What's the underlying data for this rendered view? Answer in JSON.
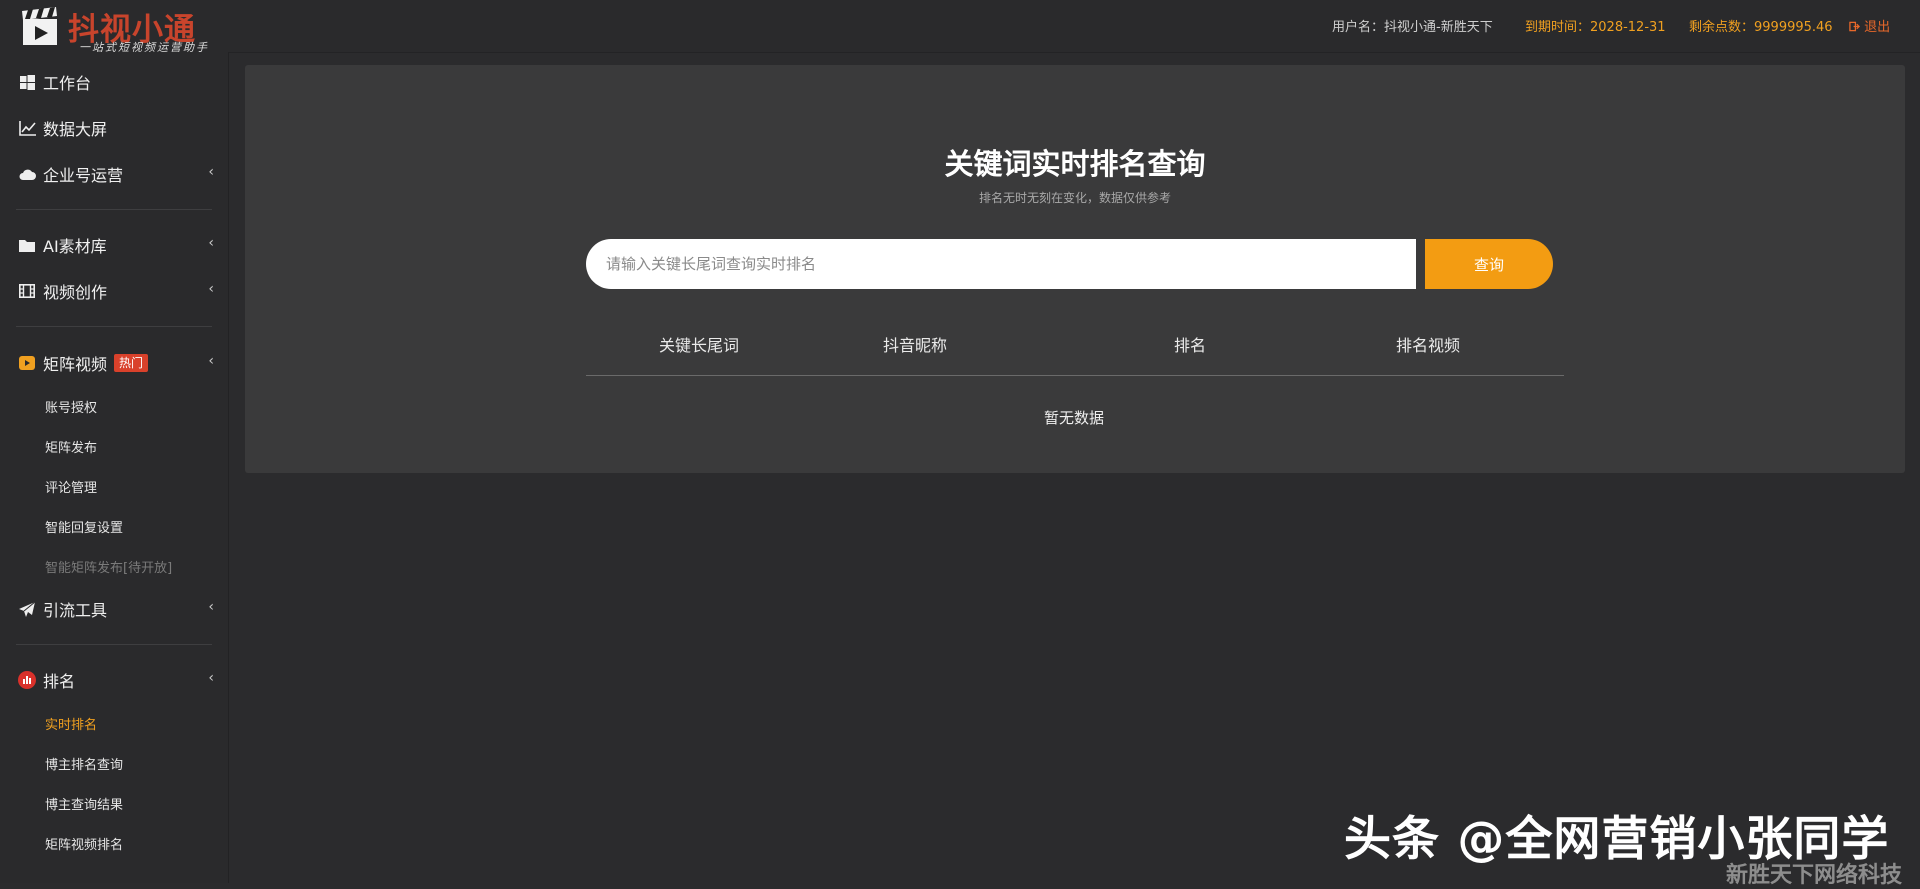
{
  "header": {
    "logo_title": "抖视小通",
    "logo_subtitle": "一站式短视频运营助手",
    "user": "用户名：抖视小通-新胜天下",
    "expire": "到期时间：2028-12-31",
    "points": "剩余点数：9999995.46",
    "logout": "退出"
  },
  "sidebar": {
    "items": [
      {
        "label": "工作台",
        "icon": "windows-icon"
      },
      {
        "label": "数据大屏",
        "icon": "line-chart-icon"
      },
      {
        "label": "企业号运营",
        "icon": "cloud-icon"
      },
      {
        "label": "AI素材库",
        "icon": "folder-icon"
      },
      {
        "label": "视频创作",
        "icon": "film-icon"
      },
      {
        "label": "矩阵视频",
        "icon": "play-badge-icon",
        "badge": "热门"
      },
      {
        "label": "引流工具",
        "icon": "paper-plane-icon"
      },
      {
        "label": "排名",
        "icon": "bar-chart-icon"
      }
    ],
    "matrix_sub": [
      "账号授权",
      "矩阵发布",
      "评论管理",
      "智能回复设置",
      "智能矩阵发布[待开放]"
    ],
    "rank_sub": [
      "实时排名",
      "博主排名查询",
      "博主查询结果",
      "矩阵视频排名"
    ]
  },
  "main": {
    "title": "关键词实时排名查询",
    "subtitle": "排名无时无刻在变化，数据仅供参考",
    "search_placeholder": "请输入关键长尾词查询实时排名",
    "search_button": "查询",
    "columns": [
      "关键长尾词",
      "抖音昵称",
      "排名",
      "排名视频"
    ],
    "empty": "暂无数据"
  },
  "watermark": {
    "main": "头条 @全网营销小张同学",
    "sub": "新胜天下网络科技"
  },
  "colors": {
    "accent": "#f39c12",
    "brand_red": "#c8442c",
    "background": "#2b2b2d",
    "panel": "#3a3a3b"
  }
}
